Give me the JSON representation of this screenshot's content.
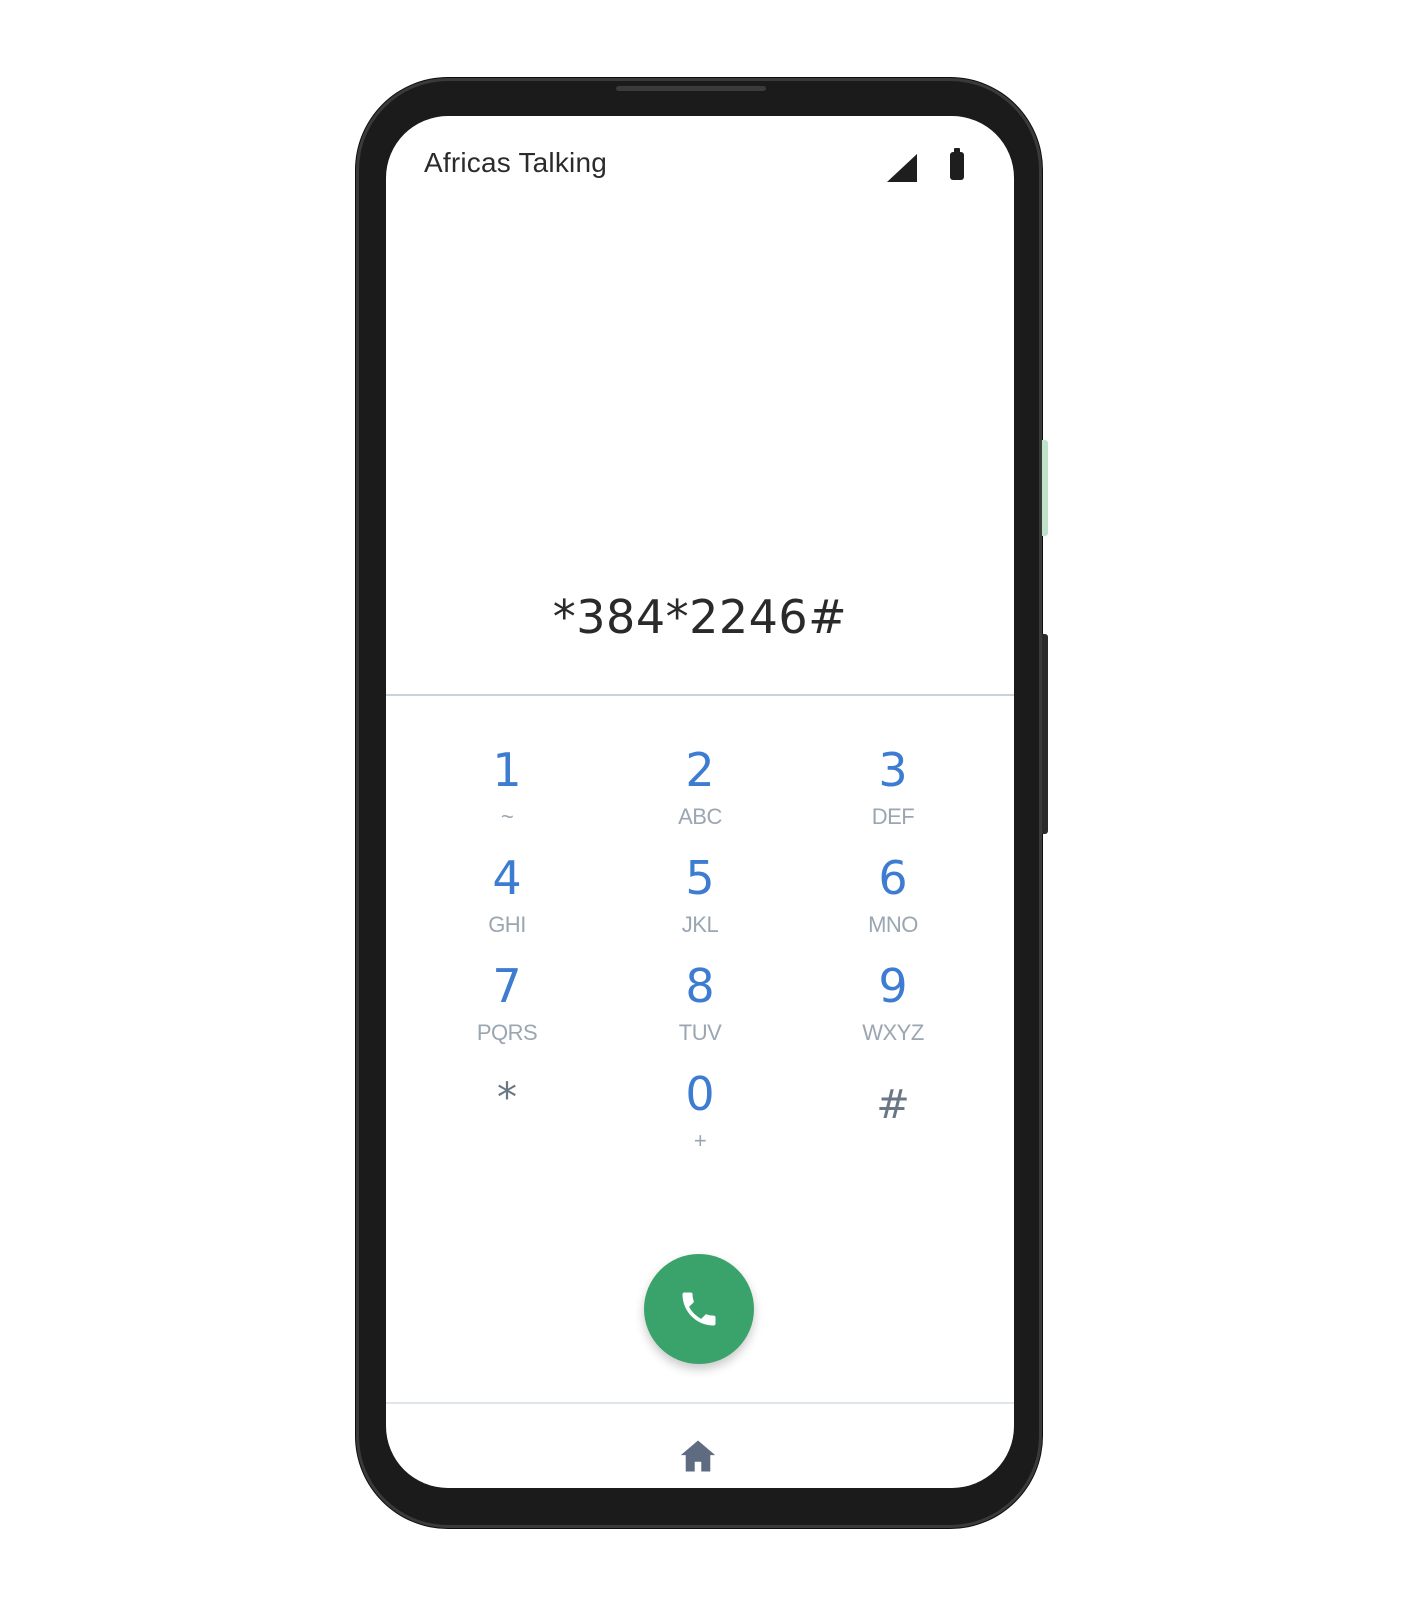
{
  "status_bar": {
    "carrier": "Africas Talking",
    "icons": [
      "signal-icon",
      "battery-icon"
    ]
  },
  "dialer": {
    "input_value": "*384*2246#",
    "keys": [
      {
        "digit": "1",
        "letters": "~"
      },
      {
        "digit": "2",
        "letters": "ABC"
      },
      {
        "digit": "3",
        "letters": "DEF"
      },
      {
        "digit": "4",
        "letters": "GHI"
      },
      {
        "digit": "5",
        "letters": "JKL"
      },
      {
        "digit": "6",
        "letters": "MNO"
      },
      {
        "digit": "7",
        "letters": "PQRS"
      },
      {
        "digit": "8",
        "letters": "TUV"
      },
      {
        "digit": "9",
        "letters": "WXYZ"
      },
      {
        "digit": "*",
        "letters": ""
      },
      {
        "digit": "0",
        "letters": "+"
      },
      {
        "digit": "#",
        "letters": ""
      }
    ]
  },
  "actions": {
    "call_icon": "phone-icon",
    "home_icon": "home-icon"
  },
  "colors": {
    "digit": "#3d7cd0",
    "letters": "#9aa6b2",
    "call_button": "#3aa36b",
    "home_icon": "#5f6b80"
  }
}
